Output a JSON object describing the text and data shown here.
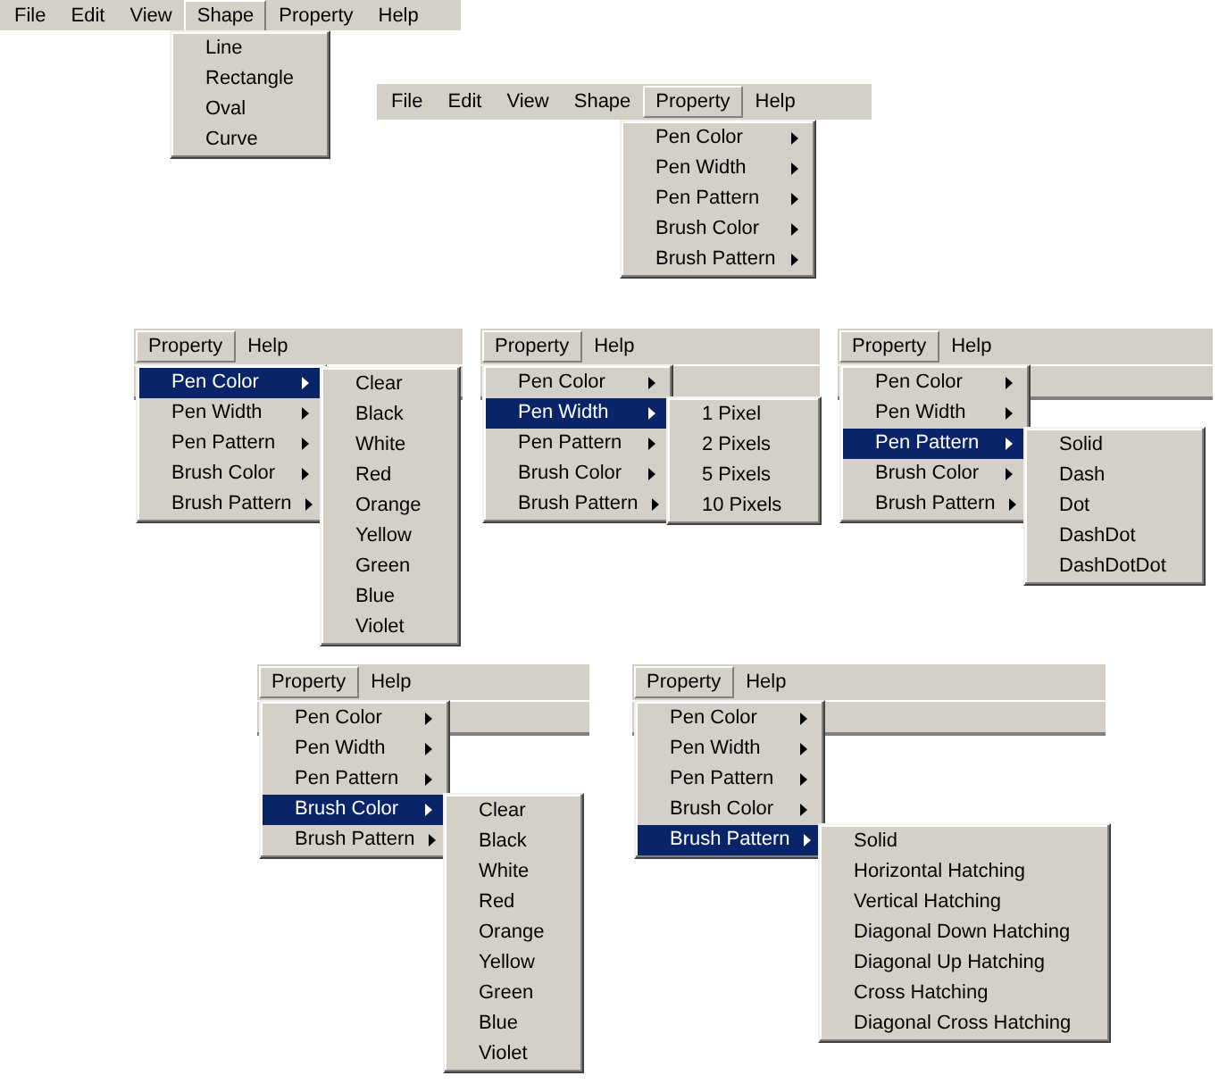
{
  "screens": [
    {
      "menubar": [
        {
          "label": "File",
          "selected": false
        },
        {
          "label": "Edit",
          "selected": false
        },
        {
          "label": "View",
          "selected": false
        },
        {
          "label": "Shape",
          "selected": true
        },
        {
          "label": "Property",
          "selected": false
        },
        {
          "label": "Help",
          "selected": false
        }
      ],
      "menu": [
        {
          "label": "Line",
          "has_submenu": false,
          "selected": false
        },
        {
          "label": "Rectangle",
          "has_submenu": false,
          "selected": false
        },
        {
          "label": "Oval",
          "has_submenu": false,
          "selected": false
        },
        {
          "label": "Curve",
          "has_submenu": false,
          "selected": false
        }
      ]
    },
    {
      "menubar": [
        {
          "label": "File",
          "selected": false
        },
        {
          "label": "Edit",
          "selected": false
        },
        {
          "label": "View",
          "selected": false
        },
        {
          "label": "Shape",
          "selected": false
        },
        {
          "label": "Property",
          "selected": true
        },
        {
          "label": "Help",
          "selected": false
        }
      ],
      "menu": [
        {
          "label": "Pen Color",
          "has_submenu": true,
          "selected": false
        },
        {
          "label": "Pen Width",
          "has_submenu": true,
          "selected": false
        },
        {
          "label": "Pen Pattern",
          "has_submenu": true,
          "selected": false
        },
        {
          "label": "Brush Color",
          "has_submenu": true,
          "selected": false
        },
        {
          "label": "Brush Pattern",
          "has_submenu": true,
          "selected": false
        }
      ]
    },
    {
      "menubar": [
        {
          "label": "Property",
          "selected": true
        },
        {
          "label": "Help",
          "selected": false
        }
      ],
      "menu": [
        {
          "label": "Pen Color",
          "has_submenu": true,
          "selected": true,
          "submenu": [
            "Clear",
            "Black",
            "White",
            "Red",
            "Orange",
            "Yellow",
            "Green",
            "Blue",
            "Violet"
          ]
        },
        {
          "label": "Pen Width",
          "has_submenu": true,
          "selected": false
        },
        {
          "label": "Pen Pattern",
          "has_submenu": true,
          "selected": false
        },
        {
          "label": "Brush Color",
          "has_submenu": true,
          "selected": false
        },
        {
          "label": "Brush Pattern",
          "has_submenu": true,
          "selected": false
        }
      ]
    },
    {
      "menubar": [
        {
          "label": "Property",
          "selected": true
        },
        {
          "label": "Help",
          "selected": false
        }
      ],
      "menu": [
        {
          "label": "Pen Color",
          "has_submenu": true,
          "selected": false
        },
        {
          "label": "Pen Width",
          "has_submenu": true,
          "selected": true,
          "submenu": [
            "1 Pixel",
            "2 Pixels",
            "5 Pixels",
            "10 Pixels"
          ]
        },
        {
          "label": "Pen Pattern",
          "has_submenu": true,
          "selected": false
        },
        {
          "label": "Brush Color",
          "has_submenu": true,
          "selected": false
        },
        {
          "label": "Brush Pattern",
          "has_submenu": true,
          "selected": false
        }
      ]
    },
    {
      "menubar": [
        {
          "label": "Property",
          "selected": true
        },
        {
          "label": "Help",
          "selected": false
        }
      ],
      "menu": [
        {
          "label": "Pen Color",
          "has_submenu": true,
          "selected": false
        },
        {
          "label": "Pen Width",
          "has_submenu": true,
          "selected": false
        },
        {
          "label": "Pen Pattern",
          "has_submenu": true,
          "selected": true,
          "submenu": [
            "Solid",
            "Dash",
            "Dot",
            "DashDot",
            "DashDotDot"
          ]
        },
        {
          "label": "Brush Color",
          "has_submenu": true,
          "selected": false
        },
        {
          "label": "Brush Pattern",
          "has_submenu": true,
          "selected": false
        }
      ]
    },
    {
      "menubar": [
        {
          "label": "Property",
          "selected": true
        },
        {
          "label": "Help",
          "selected": false
        }
      ],
      "menu": [
        {
          "label": "Pen Color",
          "has_submenu": true,
          "selected": false
        },
        {
          "label": "Pen Width",
          "has_submenu": true,
          "selected": false
        },
        {
          "label": "Pen Pattern",
          "has_submenu": true,
          "selected": false
        },
        {
          "label": "Brush Color",
          "has_submenu": true,
          "selected": true,
          "submenu": [
            "Clear",
            "Black",
            "White",
            "Red",
            "Orange",
            "Yellow",
            "Green",
            "Blue",
            "Violet"
          ]
        },
        {
          "label": "Brush Pattern",
          "has_submenu": true,
          "selected": false
        }
      ]
    },
    {
      "menubar": [
        {
          "label": "Property",
          "selected": true
        },
        {
          "label": "Help",
          "selected": false
        }
      ],
      "menu": [
        {
          "label": "Pen Color",
          "has_submenu": true,
          "selected": false
        },
        {
          "label": "Pen Width",
          "has_submenu": true,
          "selected": false
        },
        {
          "label": "Pen Pattern",
          "has_submenu": true,
          "selected": false
        },
        {
          "label": "Brush Color",
          "has_submenu": true,
          "selected": false
        },
        {
          "label": "Brush Pattern",
          "has_submenu": true,
          "selected": true,
          "submenu": [
            "Solid",
            "Horizontal Hatching",
            "Vertical Hatching",
            "Diagonal Down Hatching",
            "Diagonal Up Hatching",
            "Cross Hatching",
            "Diagonal Cross Hatching"
          ]
        }
      ]
    }
  ]
}
